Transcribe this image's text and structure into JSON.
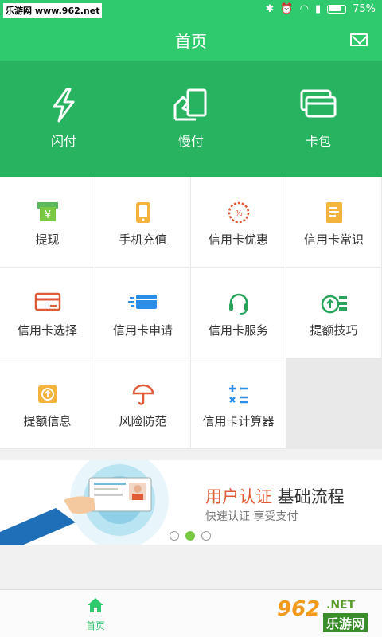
{
  "status_bar": {
    "site": "乐游网 www.962.net",
    "battery": "75%"
  },
  "header": {
    "title": "首页",
    "mail_icon": "mail-icon"
  },
  "hero": [
    {
      "label": "闪付",
      "icon": "lightning-icon"
    },
    {
      "label": "慢付",
      "icon": "hand-card-icon"
    },
    {
      "label": "卡包",
      "icon": "wallet-icon"
    }
  ],
  "grid": [
    {
      "label": "提现",
      "icon": "withdraw-icon"
    },
    {
      "label": "手机充值",
      "icon": "phone-icon"
    },
    {
      "label": "信用卡优惠",
      "icon": "discount-icon"
    },
    {
      "label": "信用卡常识",
      "icon": "book-icon"
    },
    {
      "label": "信用卡选择",
      "icon": "card-select-icon"
    },
    {
      "label": "信用卡申请",
      "icon": "card-apply-icon"
    },
    {
      "label": "信用卡服务",
      "icon": "headset-icon"
    },
    {
      "label": "提额技巧",
      "icon": "coins-up-icon"
    },
    {
      "label": "提额信息",
      "icon": "coin-info-icon"
    },
    {
      "label": "风险防范",
      "icon": "umbrella-icon"
    },
    {
      "label": "信用卡计算器",
      "icon": "calculator-icon"
    }
  ],
  "banner": {
    "title_accent": "用户认证",
    "title_rest": " 基础流程",
    "subtitle": "快速认证 享受支付",
    "active_dot": 1
  },
  "tabbar": {
    "home_label": "首页"
  },
  "watermark": {
    "num": "962",
    "net": ".NET",
    "cn": "乐游网"
  },
  "colors": {
    "green": "#2fc96e",
    "hero_green": "#27b35f",
    "accent_red": "#e15a36"
  }
}
